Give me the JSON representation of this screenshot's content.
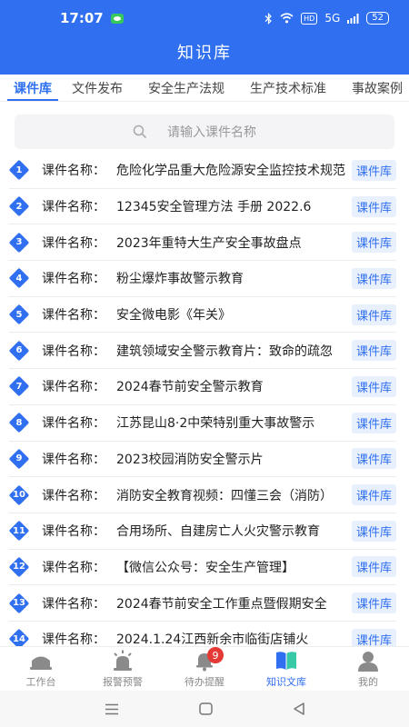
{
  "status": {
    "time": "17:07",
    "signal": "5G",
    "hd": "HD",
    "battery": "52"
  },
  "header": {
    "title": "知识库"
  },
  "tabs": [
    {
      "label": "课件库",
      "active": true
    },
    {
      "label": "文件发布"
    },
    {
      "label": "安全生产法规"
    },
    {
      "label": "生产技术标准"
    },
    {
      "label": "事故案例"
    }
  ],
  "search": {
    "placeholder": "请输入课件名称"
  },
  "list_label": "课件名称：",
  "items": [
    {
      "num": "1",
      "title": "危险化学品重大危险源安全监控技术规范",
      "badge": "课件库"
    },
    {
      "num": "2",
      "title": "12345安全管理方法 手册 2022.6",
      "badge": "课件库"
    },
    {
      "num": "3",
      "title": "2023年重特大生产安全事故盘点",
      "badge": "课件库"
    },
    {
      "num": "4",
      "title": "粉尘爆炸事故警示教育",
      "badge": "课件库"
    },
    {
      "num": "5",
      "title": "安全微电影《年关》",
      "badge": "课件库"
    },
    {
      "num": "6",
      "title": "建筑领域安全警示教育片：致命的疏忽",
      "badge": "课件库"
    },
    {
      "num": "7",
      "title": "2024春节前安全警示教育",
      "badge": "课件库"
    },
    {
      "num": "8",
      "title": "江苏昆山8·2中荣特别重大事故警示",
      "badge": "课件库"
    },
    {
      "num": "9",
      "title": "2023校园消防安全警示片",
      "badge": "课件库"
    },
    {
      "num": "10",
      "title": "消防安全教育视频：四懂三会（消防）",
      "badge": "课件库"
    },
    {
      "num": "11",
      "title": "合用场所、自建房亡人火灾警示教育",
      "badge": "课件库"
    },
    {
      "num": "12",
      "title": "【微信公众号：安全生产管理】",
      "badge": "课件库"
    },
    {
      "num": "13",
      "title": "2024春节前安全工作重点暨假期安全",
      "badge": "课件库"
    },
    {
      "num": "14",
      "title": "2024.1.24江西新余市临街店铺火",
      "badge": "课件库"
    }
  ],
  "bottom_nav": [
    {
      "label": "工作台",
      "icon": "desk-icon"
    },
    {
      "label": "报警预警",
      "icon": "alarm-icon"
    },
    {
      "label": "待办提醒",
      "icon": "bell-icon",
      "badge": "9"
    },
    {
      "label": "知识文库",
      "icon": "book-icon",
      "active": true
    },
    {
      "label": "我的",
      "icon": "user-icon"
    }
  ],
  "colors": {
    "accent": "#2f6ff0",
    "badge_bg": "#e8f0fd",
    "alert": "#e53935"
  }
}
